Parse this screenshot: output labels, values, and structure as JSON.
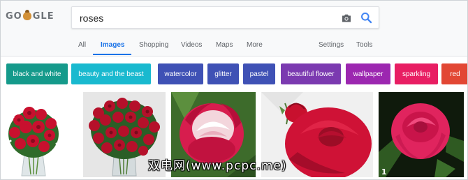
{
  "logo": {
    "letters": [
      "G",
      "O",
      "",
      "G",
      "L",
      "E"
    ]
  },
  "search": {
    "query": "roses"
  },
  "icons": {
    "camera": "camera-icon",
    "search": "search-icon"
  },
  "tabs": [
    {
      "label": "All"
    },
    {
      "label": "Images"
    },
    {
      "label": "Shopping"
    },
    {
      "label": "Videos"
    },
    {
      "label": "Maps"
    },
    {
      "label": "More"
    },
    {
      "label": "Settings"
    },
    {
      "label": "Tools"
    }
  ],
  "chips": [
    {
      "label": "black and white",
      "color": "#159a8b"
    },
    {
      "label": "beauty and the beast",
      "color": "#19b9cf"
    },
    {
      "label": "watercolor",
      "color": "#3f51b5"
    },
    {
      "label": "glitter",
      "color": "#3f51b5"
    },
    {
      "label": "pastel",
      "color": "#3f51b5"
    },
    {
      "label": "beautiful flower",
      "color": "#7b3ab0"
    },
    {
      "label": "wallpaper",
      "color": "#9c27b0"
    },
    {
      "label": "sparkling",
      "color": "#e81e63"
    },
    {
      "label": "red",
      "color": "#e24734"
    }
  ],
  "colors": {
    "accent": "#1a73e8",
    "rose_red": "#c8102e",
    "rose_pink": "#e0245e"
  },
  "watermark": "双电网(www.pcpc.me)"
}
